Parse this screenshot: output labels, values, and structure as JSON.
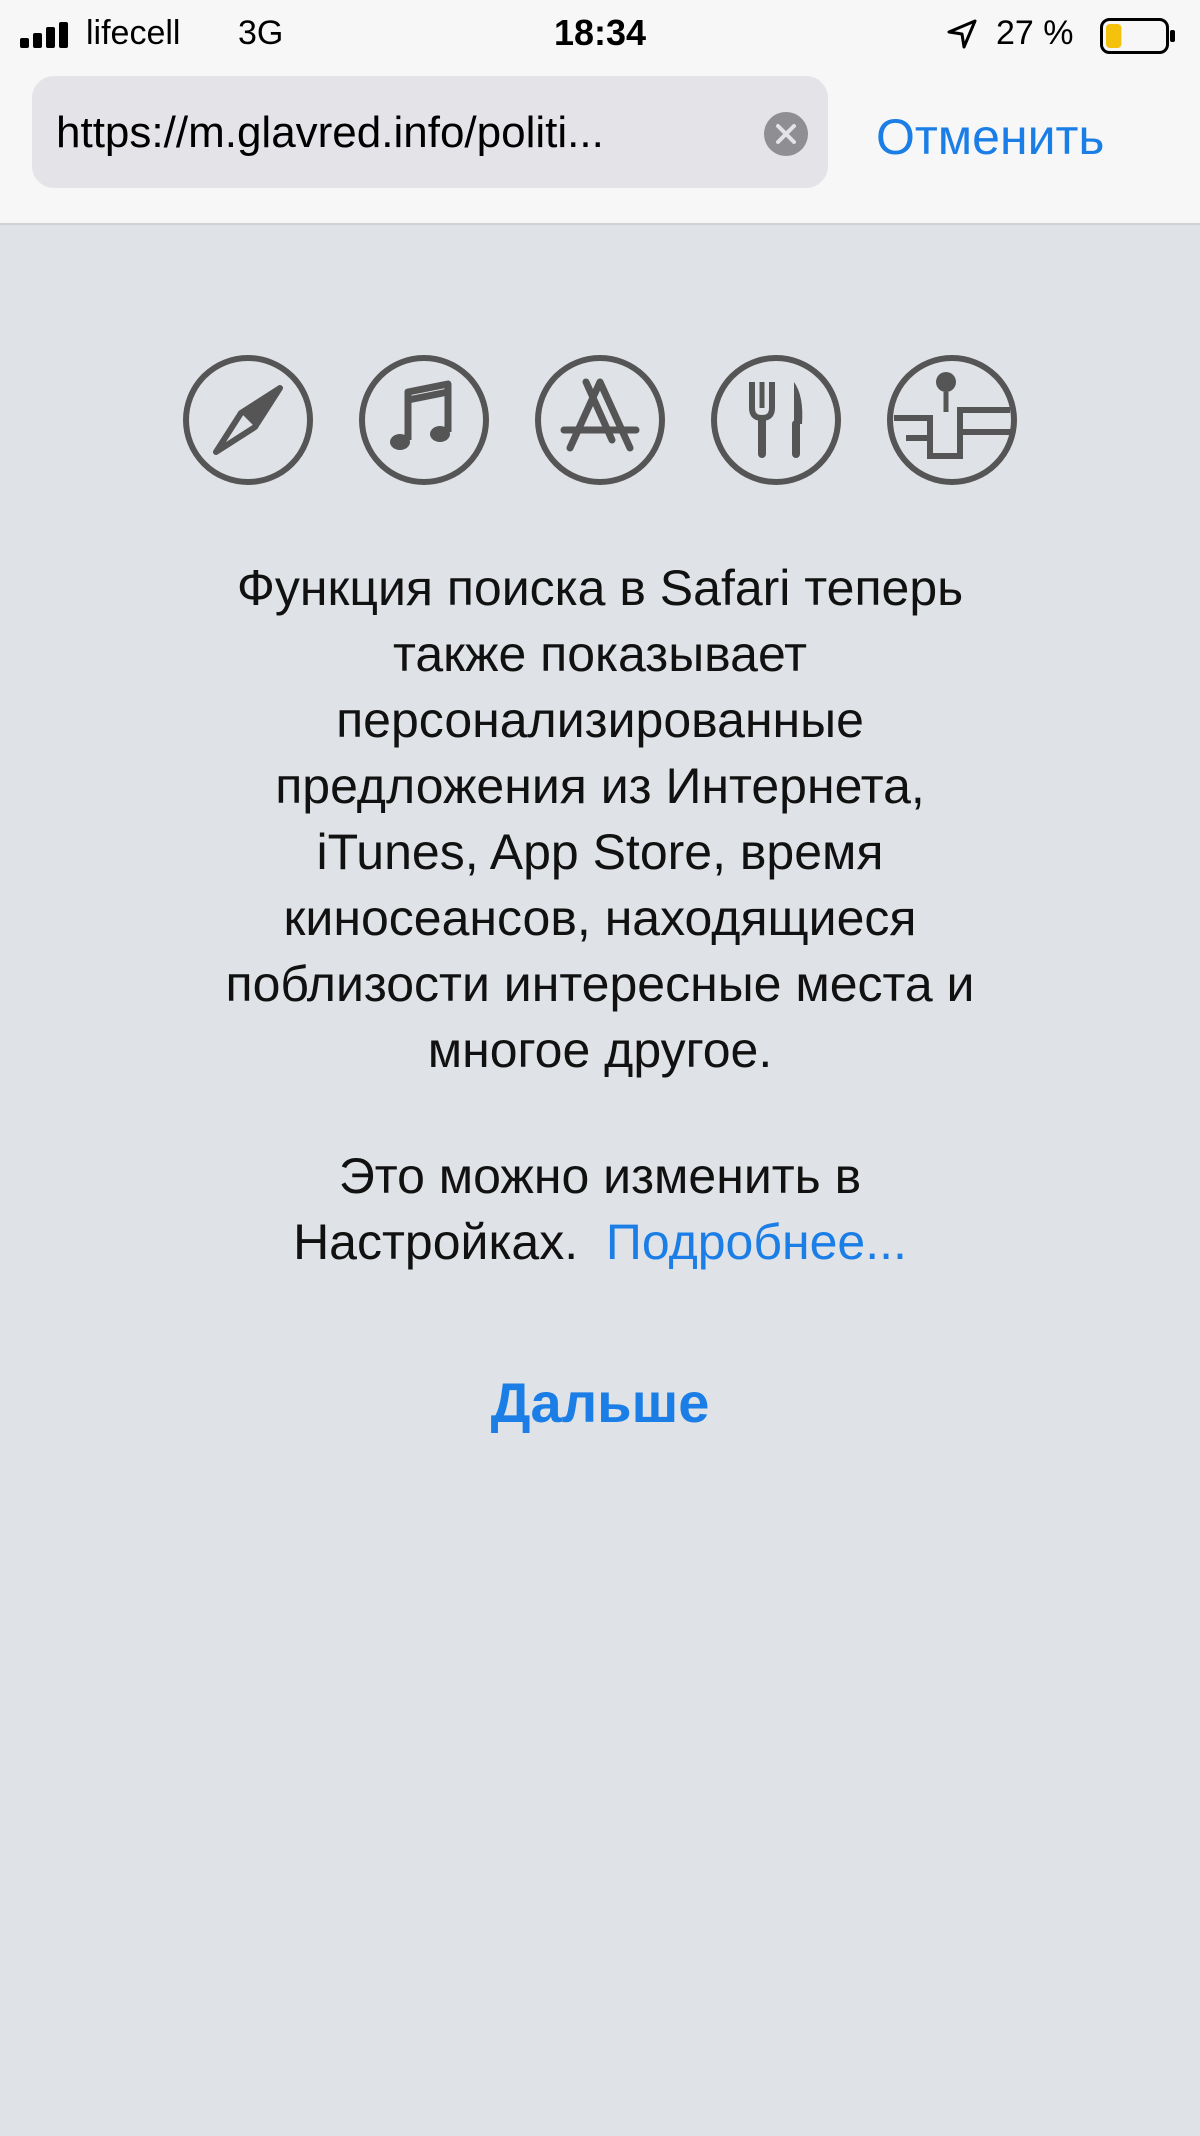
{
  "status_bar": {
    "carrier": "lifecell",
    "network": "3G",
    "time": "18:34",
    "battery_percent": "27 %",
    "battery_level": 0.27
  },
  "url_bar": {
    "url": "https://m.glavred.info/politi...",
    "cancel_label": "Отменить"
  },
  "icons": [
    {
      "name": "compass-icon"
    },
    {
      "name": "music-note-icon"
    },
    {
      "name": "app-store-icon"
    },
    {
      "name": "fork-knife-icon"
    },
    {
      "name": "map-pin-icon"
    }
  ],
  "content": {
    "description_lines": [
      "Функция поиска в Safari теперь",
      "также показывает",
      "персонализированные",
      "предложения из Интернета,",
      "iTunes, App Store, время",
      "киносеансов, находящиеся",
      "поблизости интересные места и",
      "многое другое."
    ],
    "settings_line1": "Это можно изменить в",
    "settings_line2": "Настройках.",
    "more_link": "Подробнее...",
    "continue_label": "Дальше"
  },
  "colors": {
    "accent": "#1a7ee6",
    "background": "#dfe2e6",
    "icon_stroke": "#555555"
  }
}
